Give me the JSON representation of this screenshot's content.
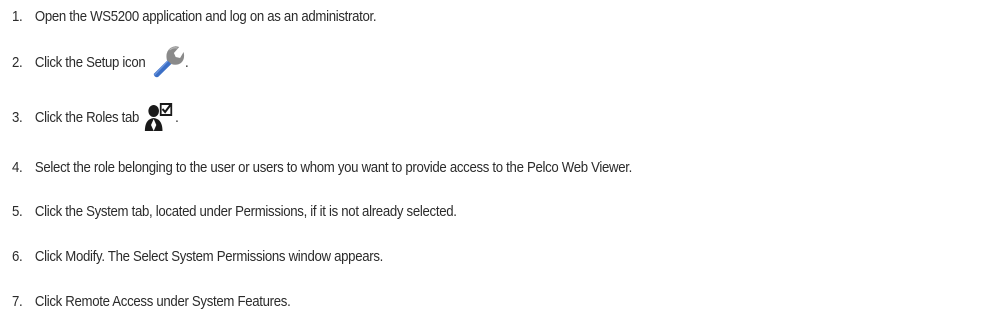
{
  "steps": [
    {
      "number": "1.",
      "text": "Open the WS5200 application and log on as an administrator."
    },
    {
      "number": "2.",
      "text_before": "Click the Setup icon",
      "icon": "setup-wrench-icon",
      "text_after": "."
    },
    {
      "number": "3.",
      "text_before": "Click the Roles tab",
      "icon": "roles-user-check-icon",
      "text_after": "."
    },
    {
      "number": "4.",
      "text": "Select the role belonging to the user or users to whom you want to provide access to the Pelco Web Viewer."
    },
    {
      "number": "5.",
      "text": "Click the System tab, located under Permissions, if it is not already selected."
    },
    {
      "number": "6.",
      "text": "Click Modify. The Select System Permissions window appears."
    },
    {
      "number": "7.",
      "text": "Click Remote Access under System Features."
    }
  ],
  "colors": {
    "text": "#2b2b2b",
    "setup_icon_handle": "#3b6fc6",
    "setup_icon_head": "#8a8a8a",
    "roles_icon": "#1a1a1a"
  }
}
